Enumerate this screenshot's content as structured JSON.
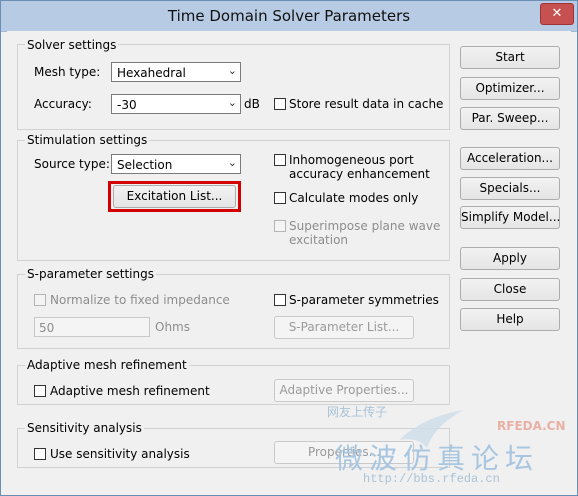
{
  "window": {
    "title": "Time Domain Solver Parameters",
    "close_glyph": "✕"
  },
  "solver": {
    "title": "Solver settings",
    "mesh_type_label": "Mesh type:",
    "mesh_type_value": "Hexahedral",
    "accuracy_label": "Accuracy:",
    "accuracy_value": "-30",
    "accuracy_unit": "dB",
    "store_cache_label": "Store result data in cache",
    "store_cache_checked": false
  },
  "stimulation": {
    "title": "Stimulation settings",
    "source_type_label": "Source type:",
    "source_type_value": "Selection",
    "excitation_list_button": "Excitation List...",
    "inhomogeneous_line1": "Inhomogeneous port",
    "inhomogeneous_line2": "accuracy enhancement",
    "calculate_modes_label": "Calculate modes only",
    "superimpose_line1": "Superimpose plane wave",
    "superimpose_line2": "excitation"
  },
  "sparam": {
    "title": "S-parameter settings",
    "normalize_label": "Normalize to fixed impedance",
    "impedance_value": "50",
    "impedance_unit": "Ohms",
    "symmetries_label": "S-parameter symmetries",
    "list_button": "S-Parameter List..."
  },
  "adaptive": {
    "title": "Adaptive mesh refinement",
    "checkbox_label": "Adaptive mesh refinement",
    "properties_button": "Adaptive Properties..."
  },
  "sensitivity": {
    "title": "Sensitivity analysis",
    "checkbox_label": "Use sensitivity analysis",
    "properties_button": "Properties..."
  },
  "buttons": {
    "start": "Start",
    "optimizer": "Optimizer...",
    "par_sweep": "Par. Sweep...",
    "acceleration": "Acceleration...",
    "specials": "Specials...",
    "simplify_model": "Simplify Model...",
    "apply": "Apply",
    "close": "Close",
    "help": "Help"
  },
  "watermark": {
    "chinese_small": "网友上传子",
    "brand": "RFEDA.CN",
    "chinese_large": "微波仿真论坛",
    "url": "http://bbs.rfeda.cn"
  },
  "colors": {
    "highlight": "#d20000",
    "title_bar": "#b7cbe4",
    "close_button": "#c75050"
  }
}
